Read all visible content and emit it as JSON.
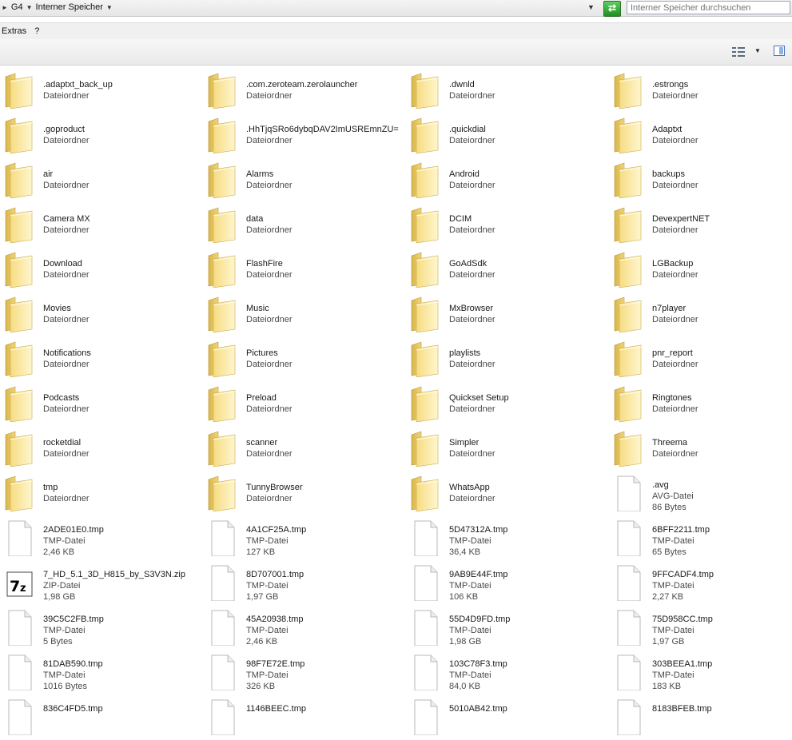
{
  "address": {
    "crumbs": [
      "G4",
      "Interner Speicher"
    ],
    "search_placeholder": "Interner Speicher durchsuchen"
  },
  "menu": [
    "Extras",
    "?"
  ],
  "items": [
    {
      "name": ".adaptxt_back_up",
      "type": "Dateiordner",
      "size": "",
      "kind": "folder"
    },
    {
      "name": ".com.zeroteam.zerolauncher",
      "type": "Dateiordner",
      "size": "",
      "kind": "folder"
    },
    {
      "name": ".dwnld",
      "type": "Dateiordner",
      "size": "",
      "kind": "folder"
    },
    {
      "name": ".estrongs",
      "type": "Dateiordner",
      "size": "",
      "kind": "folder"
    },
    {
      "name": ".goproduct",
      "type": "Dateiordner",
      "size": "",
      "kind": "folder"
    },
    {
      "name": ".HhTjqSRo6dybqDAV2ImUSREmnZU=",
      "type": "Dateiordner",
      "size": "",
      "kind": "folder"
    },
    {
      "name": ".quickdial",
      "type": "Dateiordner",
      "size": "",
      "kind": "folder"
    },
    {
      "name": "Adaptxt",
      "type": "Dateiordner",
      "size": "",
      "kind": "folder"
    },
    {
      "name": "air",
      "type": "Dateiordner",
      "size": "",
      "kind": "folder"
    },
    {
      "name": "Alarms",
      "type": "Dateiordner",
      "size": "",
      "kind": "folder"
    },
    {
      "name": "Android",
      "type": "Dateiordner",
      "size": "",
      "kind": "folder"
    },
    {
      "name": "backups",
      "type": "Dateiordner",
      "size": "",
      "kind": "folder"
    },
    {
      "name": "Camera MX",
      "type": "Dateiordner",
      "size": "",
      "kind": "folder"
    },
    {
      "name": "data",
      "type": "Dateiordner",
      "size": "",
      "kind": "folder"
    },
    {
      "name": "DCIM",
      "type": "Dateiordner",
      "size": "",
      "kind": "folder"
    },
    {
      "name": "DevexpertNET",
      "type": "Dateiordner",
      "size": "",
      "kind": "folder"
    },
    {
      "name": "Download",
      "type": "Dateiordner",
      "size": "",
      "kind": "folder"
    },
    {
      "name": "FlashFire",
      "type": "Dateiordner",
      "size": "",
      "kind": "folder"
    },
    {
      "name": "GoAdSdk",
      "type": "Dateiordner",
      "size": "",
      "kind": "folder"
    },
    {
      "name": "LGBackup",
      "type": "Dateiordner",
      "size": "",
      "kind": "folder"
    },
    {
      "name": "Movies",
      "type": "Dateiordner",
      "size": "",
      "kind": "folder"
    },
    {
      "name": "Music",
      "type": "Dateiordner",
      "size": "",
      "kind": "folder"
    },
    {
      "name": "MxBrowser",
      "type": "Dateiordner",
      "size": "",
      "kind": "folder"
    },
    {
      "name": "n7player",
      "type": "Dateiordner",
      "size": "",
      "kind": "folder"
    },
    {
      "name": "Notifications",
      "type": "Dateiordner",
      "size": "",
      "kind": "folder"
    },
    {
      "name": "Pictures",
      "type": "Dateiordner",
      "size": "",
      "kind": "folder"
    },
    {
      "name": "playlists",
      "type": "Dateiordner",
      "size": "",
      "kind": "folder"
    },
    {
      "name": "pnr_report",
      "type": "Dateiordner",
      "size": "",
      "kind": "folder"
    },
    {
      "name": "Podcasts",
      "type": "Dateiordner",
      "size": "",
      "kind": "folder"
    },
    {
      "name": "Preload",
      "type": "Dateiordner",
      "size": "",
      "kind": "folder"
    },
    {
      "name": "Quickset Setup",
      "type": "Dateiordner",
      "size": "",
      "kind": "folder"
    },
    {
      "name": "Ringtones",
      "type": "Dateiordner",
      "size": "",
      "kind": "folder"
    },
    {
      "name": "rocketdial",
      "type": "Dateiordner",
      "size": "",
      "kind": "folder"
    },
    {
      "name": "scanner",
      "type": "Dateiordner",
      "size": "",
      "kind": "folder"
    },
    {
      "name": "Simpler",
      "type": "Dateiordner",
      "size": "",
      "kind": "folder"
    },
    {
      "name": "Threema",
      "type": "Dateiordner",
      "size": "",
      "kind": "folder"
    },
    {
      "name": "tmp",
      "type": "Dateiordner",
      "size": "",
      "kind": "folder"
    },
    {
      "name": "TunnyBrowser",
      "type": "Dateiordner",
      "size": "",
      "kind": "folder"
    },
    {
      "name": "WhatsApp",
      "type": "Dateiordner",
      "size": "",
      "kind": "folder"
    },
    {
      "name": ".avg",
      "type": "AVG-Datei",
      "size": "86 Bytes",
      "kind": "file"
    },
    {
      "name": "2ADE01E0.tmp",
      "type": "TMP-Datei",
      "size": "2,46 KB",
      "kind": "file"
    },
    {
      "name": "4A1CF25A.tmp",
      "type": "TMP-Datei",
      "size": "127 KB",
      "kind": "file"
    },
    {
      "name": "5D47312A.tmp",
      "type": "TMP-Datei",
      "size": "36,4 KB",
      "kind": "file"
    },
    {
      "name": "6BFF2211.tmp",
      "type": "TMP-Datei",
      "size": "65 Bytes",
      "kind": "file"
    },
    {
      "name": "7_HD_5.1_3D_H815_by_S3V3N.zip",
      "type": "ZIP-Datei",
      "size": "1,98 GB",
      "kind": "zip"
    },
    {
      "name": "8D707001.tmp",
      "type": "TMP-Datei",
      "size": "1,97 GB",
      "kind": "file"
    },
    {
      "name": "9AB9E44F.tmp",
      "type": "TMP-Datei",
      "size": "106 KB",
      "kind": "file"
    },
    {
      "name": "9FFCADF4.tmp",
      "type": "TMP-Datei",
      "size": "2,27 KB",
      "kind": "file"
    },
    {
      "name": "39C5C2FB.tmp",
      "type": "TMP-Datei",
      "size": "5 Bytes",
      "kind": "file"
    },
    {
      "name": "45A20938.tmp",
      "type": "TMP-Datei",
      "size": "2,46 KB",
      "kind": "file"
    },
    {
      "name": "55D4D9FD.tmp",
      "type": "TMP-Datei",
      "size": "1,98 GB",
      "kind": "file"
    },
    {
      "name": "75D958CC.tmp",
      "type": "TMP-Datei",
      "size": "1,97 GB",
      "kind": "file"
    },
    {
      "name": "81DAB590.tmp",
      "type": "TMP-Datei",
      "size": "1016 Bytes",
      "kind": "file"
    },
    {
      "name": "98F7E72E.tmp",
      "type": "TMP-Datei",
      "size": "326 KB",
      "kind": "file"
    },
    {
      "name": "103C78F3.tmp",
      "type": "TMP-Datei",
      "size": "84,0 KB",
      "kind": "file"
    },
    {
      "name": "303BEEA1.tmp",
      "type": "TMP-Datei",
      "size": "183 KB",
      "kind": "file"
    },
    {
      "name": "836C4FD5.tmp",
      "type": "",
      "size": "",
      "kind": "file"
    },
    {
      "name": "1146BEEC.tmp",
      "type": "",
      "size": "",
      "kind": "file"
    },
    {
      "name": "5010AB42.tmp",
      "type": "",
      "size": "",
      "kind": "file"
    },
    {
      "name": "8183BFEB.tmp",
      "type": "",
      "size": "",
      "kind": "file"
    }
  ],
  "icons": {
    "folder": "folder-icon",
    "file": "file-icon",
    "zip": "7z-archive-icon",
    "refresh": "refresh-icon",
    "views": "change-view-icon",
    "pane": "preview-pane-icon"
  },
  "colors": {
    "folder_light": "#fbeeb0",
    "folder_dark": "#e2c35a",
    "refresh_green": "#2ea52e"
  }
}
